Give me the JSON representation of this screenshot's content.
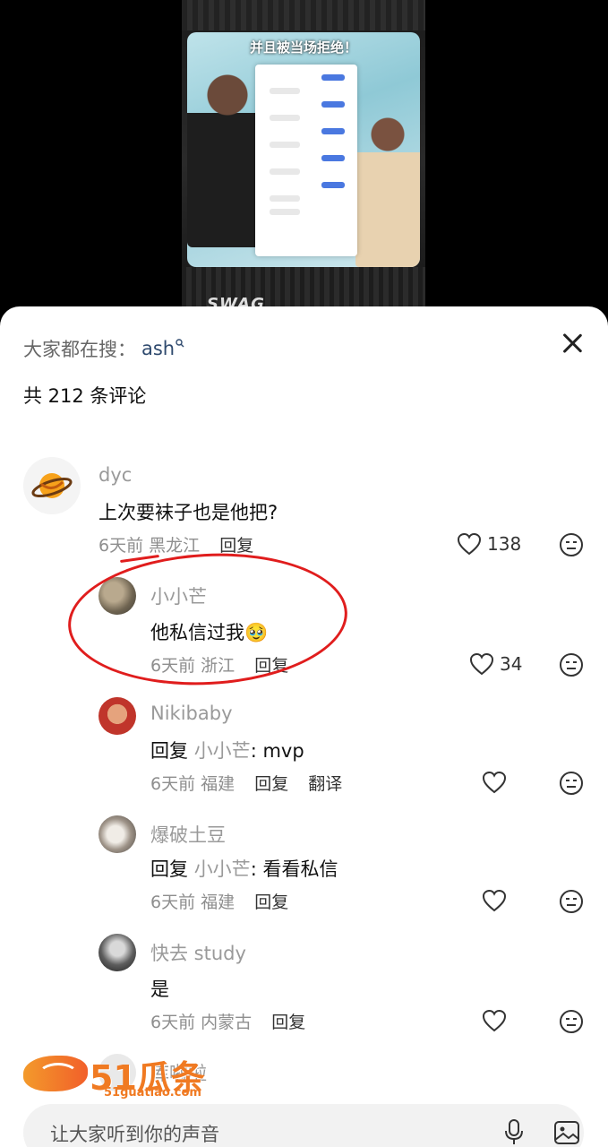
{
  "video": {
    "caption": "并且被当场拒绝！",
    "watermark": "SWAG"
  },
  "sheet": {
    "search_prefix": "大家都在搜：",
    "search_term": "ash",
    "comment_count_label": "共 212 条评论"
  },
  "comments": [
    {
      "username": "dyc",
      "text": "上次要袜子也是他把?",
      "time": "6天前",
      "location": "黑龙江",
      "reply_label": "回复",
      "likes": "138",
      "avatar_icon": "planet-icon"
    },
    {
      "username": "小小芒",
      "text": "他私信过我",
      "emoji": "🥹",
      "time": "6天前",
      "location": "浙江",
      "reply_label": "回复",
      "likes": "34",
      "avatar_icon": "cat-photo"
    },
    {
      "username": "Nikibaby",
      "reply_prefix": "回复",
      "reply_to": "小小芒",
      "text": ": mvp",
      "time": "6天前",
      "location": "福建",
      "reply_label": "回复",
      "translate_label": "翻译"
    },
    {
      "username": "爆破土豆",
      "reply_prefix": "回复",
      "reply_to": "小小芒",
      "text": ": 看看私信",
      "time": "6天前",
      "location": "福建",
      "reply_label": "回复"
    },
    {
      "username": "快去 study",
      "text": "是",
      "time": "6天前",
      "location": "内蒙古",
      "reply_label": "回复"
    },
    {
      "username": "库啦啦"
    }
  ],
  "input": {
    "placeholder": "让大家听到你的声音"
  },
  "logo": {
    "brand": "51瓜条",
    "url": "51guatiao.com"
  },
  "colors": {
    "annotation_red": "#e01d1d",
    "search_term": "#2f4a6e",
    "logo_orange": "#f07a22"
  }
}
